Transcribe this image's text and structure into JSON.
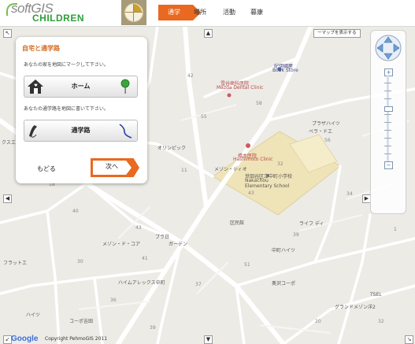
{
  "app": {
    "logo_soft": "softGIS",
    "logo_children": "CHILDREN"
  },
  "nav": {
    "tabs": [
      {
        "label": "通学",
        "active": true
      },
      {
        "label": "場所",
        "active": false
      },
      {
        "label": "活動",
        "active": false
      },
      {
        "label": "暮康",
        "active": false
      }
    ]
  },
  "panel": {
    "title": "自宅と通学路",
    "home_instruction": "あなたの家を地図にマークして下さい。",
    "home_button_label": "ホーム",
    "route_instruction": "あなたの通学路を地図に書いて下さい。",
    "route_button_label": "通学路",
    "back_label": "もどる",
    "next_label": "次へ"
  },
  "map": {
    "map_type_label": "ーマップを表示する",
    "labels": {
      "book_store_jp": "紀伊國屋",
      "book_store_en": "Book Store",
      "dental_jp": "雪谷歯科医院",
      "dental_en": "Mazda Dental Clinic",
      "clinic_jp": "橋本医院",
      "clinic_en": "Hashimoto Clinic",
      "school_jp": "世田谷区立中町小学校",
      "school_en1": "Nakachou",
      "school_en2": "Elementary School",
      "shop1": "オリンピック",
      "shop2": "ライフ ディ",
      "apt1": "メゾン・ディオ",
      "apt2": "グランドメゾン洋2",
      "apt3": "ハイムアレックス中町",
      "kominkan": "区民館",
      "tsel": "TSEL",
      "mansion1": "奥沢コーポ",
      "mansion2": "中町ハイツ",
      "mansion3": "メゾン・ド・コア",
      "shop3": "ガーデン",
      "label_left1": "クスエ",
      "label_left2": "フラットエ",
      "label_left3": "ハイツ",
      "label_right1": "プラザハイツ",
      "label_right2": "ベラ・ドエ",
      "store1": "ブラ日",
      "store2": "コーポ吉田"
    },
    "block_numbers": [
      "42",
      "58",
      "55",
      "56",
      "11",
      "32",
      "43",
      "18",
      "40",
      "34",
      "39",
      "51",
      "43",
      "41",
      "37",
      "1",
      "36",
      "30",
      "20",
      "32",
      "39"
    ]
  },
  "footer": {
    "google": "Google",
    "copyright": "Copyright PehmoGIS 2011"
  },
  "colors": {
    "accent": "#e8691f",
    "title": "#d36a1e",
    "logo_green": "#2f9e3a",
    "map_bg": "#ecebe6",
    "school_fill": "#efe3b8"
  },
  "icons": {
    "home": "house-icon",
    "pin": "green-pin-icon",
    "pencil": "pencil-icon",
    "route": "route-line-icon",
    "compass": "compass-icon"
  }
}
